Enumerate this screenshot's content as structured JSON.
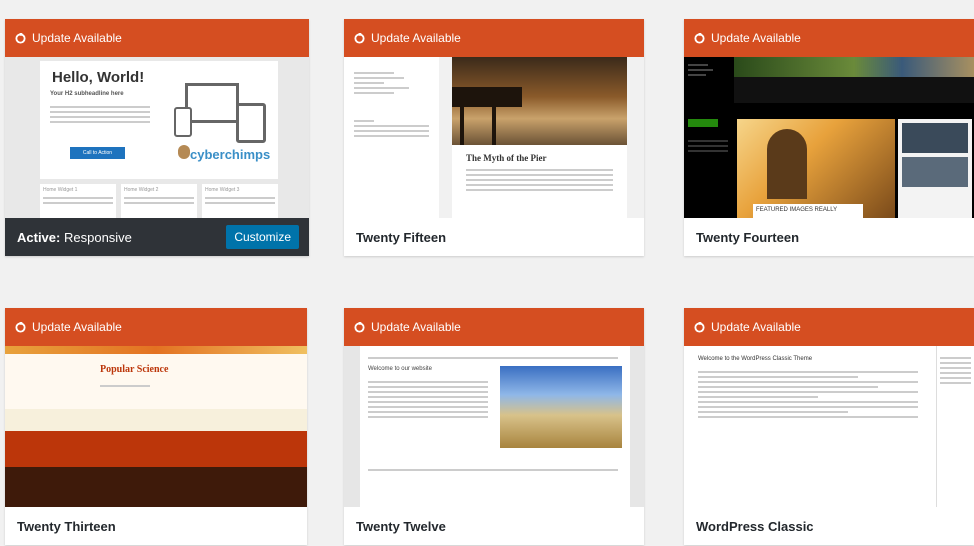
{
  "update_label": "Update Available",
  "themes": [
    {
      "name": "Responsive",
      "active_prefix": "Active:",
      "button": "Customize"
    },
    {
      "name": "Twenty Fifteen"
    },
    {
      "name": "Twenty Fourteen"
    },
    {
      "name": "Twenty Thirteen"
    },
    {
      "name": "Twenty Twelve"
    },
    {
      "name": "WordPress Classic"
    }
  ],
  "previews": {
    "responsive": {
      "headline": "Hello, World!",
      "subhead": "Your H2 subheadline here",
      "cta": "Call to Action",
      "brand": "cyberchimps",
      "widgets": [
        "Home Widget 1",
        "Home Widget 2",
        "Home Widget 3"
      ]
    },
    "fifteen": {
      "post_title": "The Myth of the Pier"
    },
    "fourteen": {
      "featured": "FEATURED IMAGES REALLY"
    },
    "thirteen": {
      "site_title": "Popular Science"
    },
    "twelve": {
      "welcome": "Welcome to our website"
    },
    "classic": {
      "post_title": "Welcome to the WordPress Classic Theme"
    }
  },
  "colors": {
    "banner": "#d54e21",
    "accent": "#0073aa",
    "active_footer": "#2f3338"
  }
}
